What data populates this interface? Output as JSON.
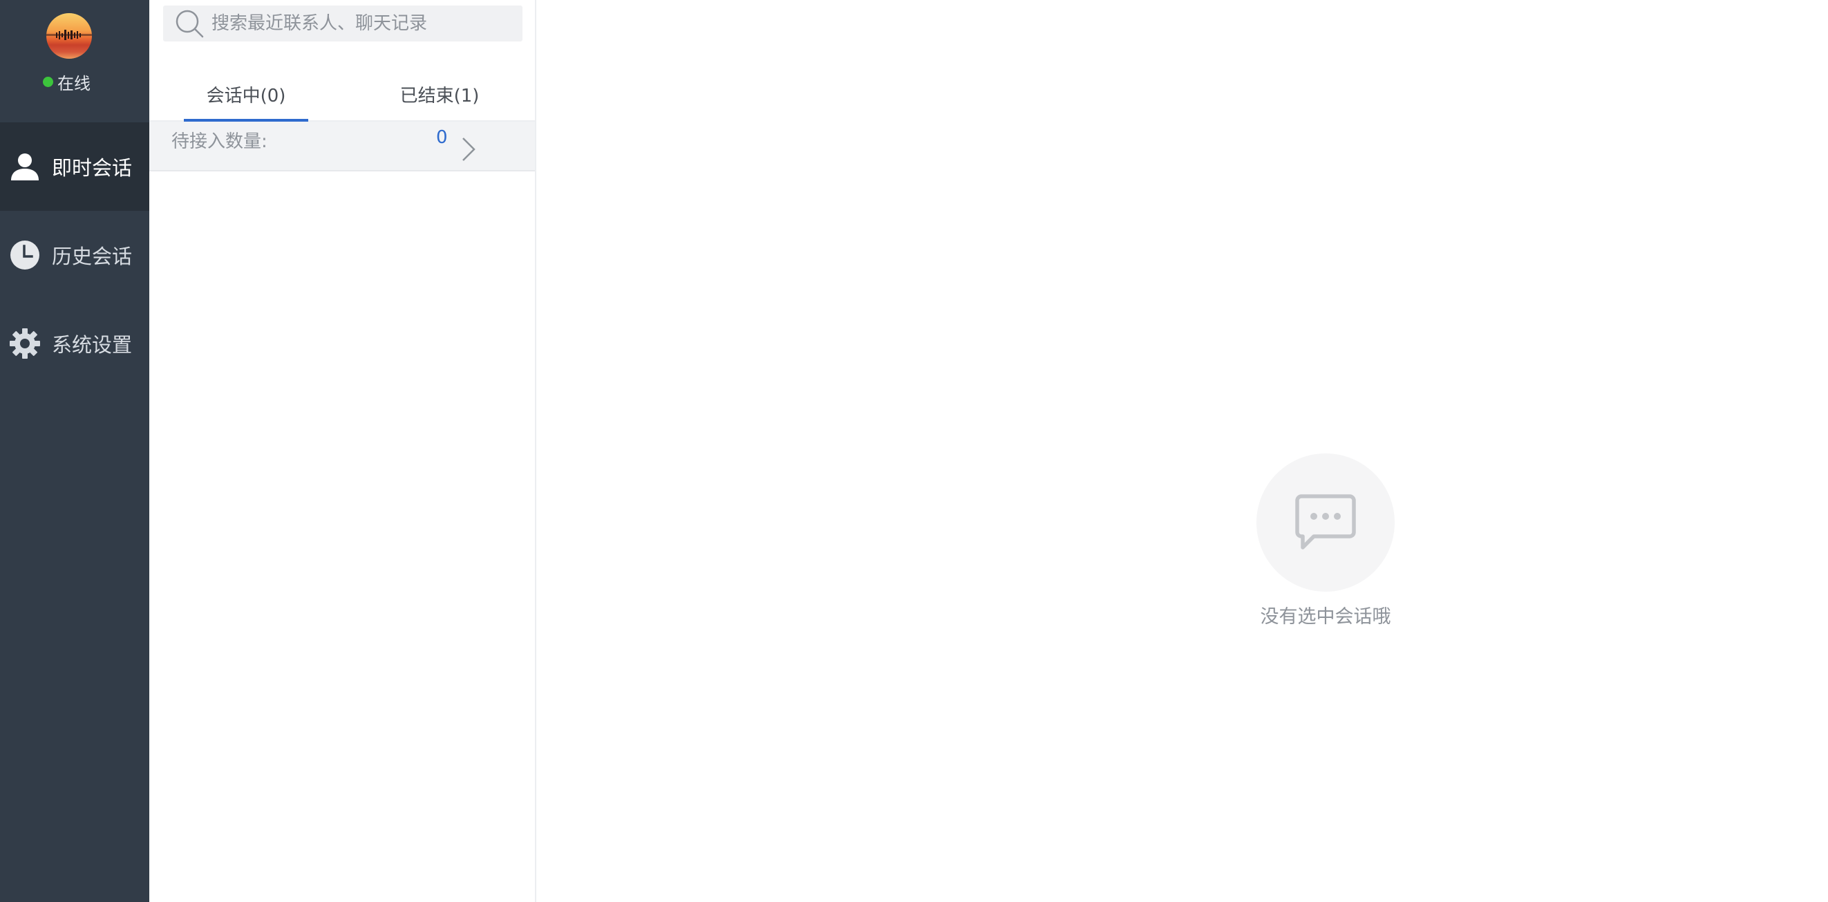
{
  "sidebar": {
    "status_label": "在线",
    "status_color": "#3cc43c",
    "nav_items": [
      {
        "label": "即时会话",
        "icon": "user-icon",
        "active": true
      },
      {
        "label": "历史会话",
        "icon": "clock-icon",
        "active": false
      },
      {
        "label": "系统设置",
        "icon": "gear-icon",
        "active": false
      }
    ]
  },
  "conversation_list": {
    "search_placeholder": "搜索最近联系人、聊天记录",
    "tabs": [
      {
        "label": "会话中(0)",
        "active": true
      },
      {
        "label": "已结束(1)",
        "active": false
      }
    ],
    "pending": {
      "label": "待接入数量:",
      "count": "0"
    }
  },
  "main": {
    "empty_text": "没有选中会话哦",
    "empty_icon": "chat-bubble-icon"
  },
  "colors": {
    "sidebar_bg": "#323c48",
    "sidebar_active_bg": "#283039",
    "accent": "#2f6bce",
    "muted_text": "#8e939a"
  }
}
